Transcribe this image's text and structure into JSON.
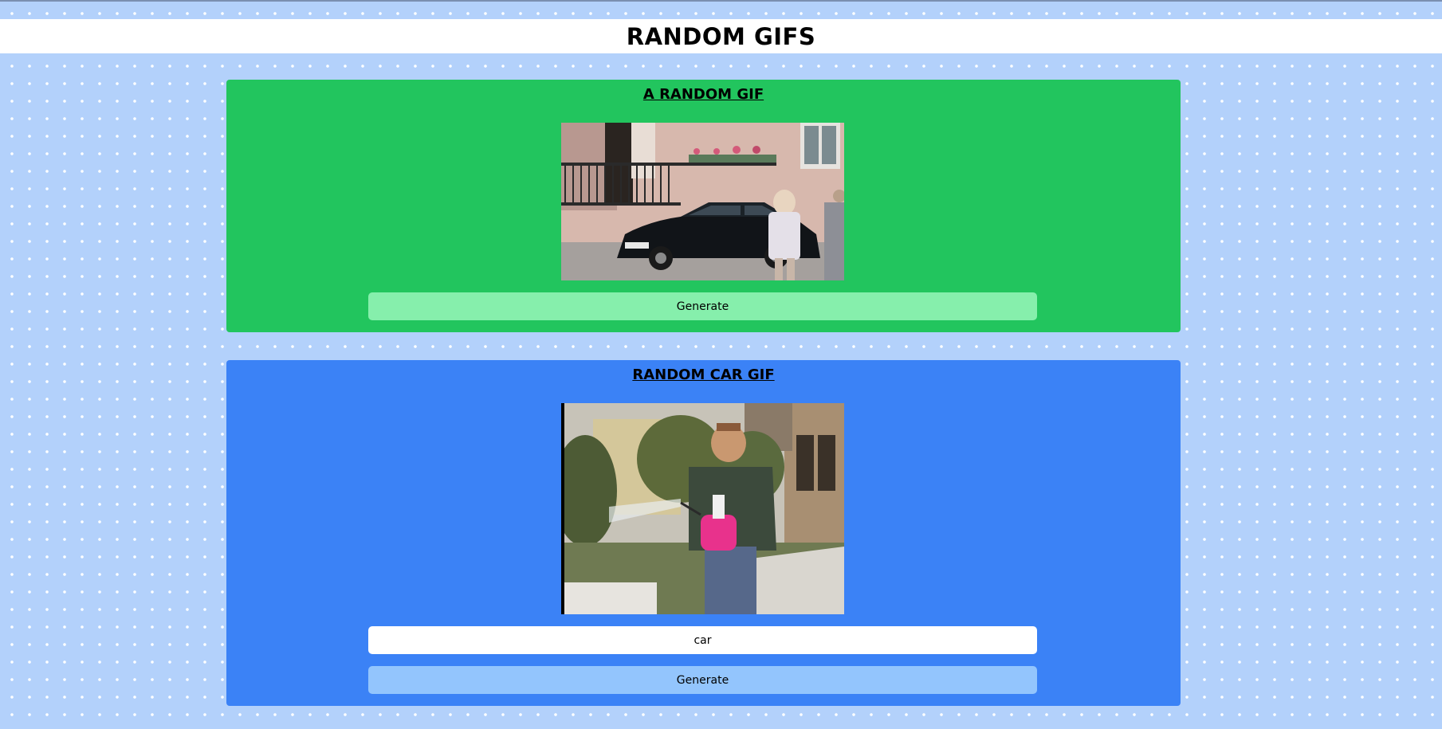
{
  "header": {
    "title": "RANDOM GIFS"
  },
  "random_card": {
    "title": "A RANDOM GIF",
    "image_name": "random-gif-image",
    "generate_label": "Generate",
    "color": "#22c55e",
    "button_color": "#86efac"
  },
  "tag_card": {
    "title": "RANDOM CAR GIF",
    "image_name": "car-gif-image",
    "tag_value": "car",
    "generate_label": "Generate",
    "color": "#3b82f6",
    "button_color": "#93c5fd"
  },
  "colors": {
    "page_background": "#b3d1fb",
    "header_background": "#ffffff"
  }
}
